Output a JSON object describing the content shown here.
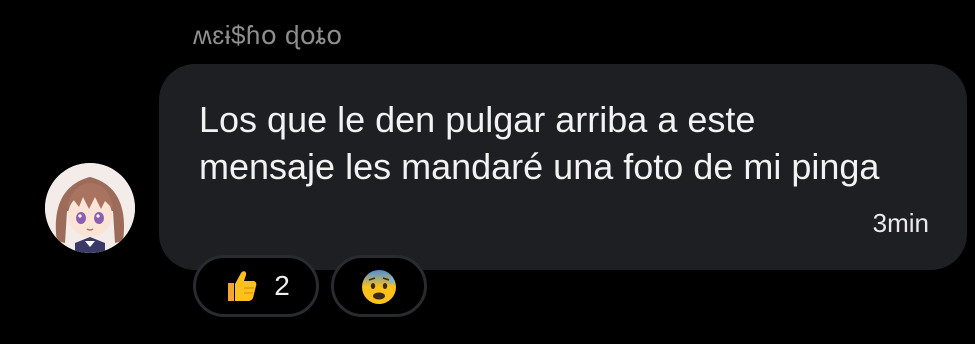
{
  "message": {
    "sender_name": "ʍɛɨ$ɦօ ɖօȶօ",
    "text": "Los que le den pulgar arriba a este mensaje les mandaré una foto de mi pinga",
    "timestamp": "3min"
  },
  "avatar": {
    "icon": "anime-girl-avatar"
  },
  "reactions": [
    {
      "icon": "thumbs-up-emoji",
      "count": "2"
    },
    {
      "icon": "anxious-face-with-sweat-emoji"
    }
  ],
  "colors": {
    "background": "#000000",
    "bubble": "#1e1f23",
    "text": "#f2f2f2",
    "muted": "#8e8e8e",
    "reaction_border": "#2a2b2f"
  }
}
